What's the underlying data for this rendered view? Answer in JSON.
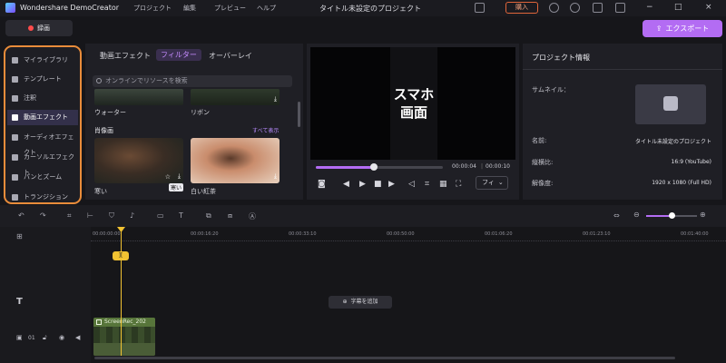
{
  "app": {
    "name": "Wondershare DemoCreator",
    "menu": [
      "プロジェクト",
      "編集",
      "プレビュー",
      "ヘルプ"
    ],
    "title": "タイトル未設定のプロジェクト",
    "buy_label": "購入",
    "window_controls": [
      "−",
      "□",
      "×"
    ]
  },
  "toolbar": {
    "record_label": "録画",
    "export_label": "エクスポート"
  },
  "sidebar": {
    "items": [
      {
        "label": "マイライブラリ",
        "icon": "stack-icon",
        "active": false
      },
      {
        "label": "テンプレート",
        "icon": "template-icon",
        "active": false
      },
      {
        "label": "注釈",
        "icon": "annotation-icon",
        "active": false
      },
      {
        "label": "動画エフェクト",
        "icon": "effects-icon",
        "active": true
      },
      {
        "label": "オーディオエフェクト",
        "icon": "audio-effects-icon",
        "active": false
      },
      {
        "label": "カーソルエフェクト",
        "icon": "cursor-icon",
        "active": false
      },
      {
        "label": "パンとズーム",
        "icon": "pan-zoom-icon",
        "active": false
      },
      {
        "label": "トランジション",
        "icon": "transition-icon",
        "active": false
      }
    ]
  },
  "library": {
    "tabs": [
      "動画エフェクト",
      "フィルター",
      "オーバーレイ"
    ],
    "active_tab": "フィルター",
    "search_placeholder": "オンラインでリソースを検索",
    "top_items": [
      "ウォーター",
      "リボン"
    ],
    "section_title": "肖像画",
    "see_all": "すべて表示",
    "items": [
      {
        "label": "寒い"
      },
      {
        "label": "白い紅茶"
      }
    ],
    "tooltip": "寒い"
  },
  "preview": {
    "overlay_line1": "スマホ",
    "overlay_line2": "画面",
    "progress": 0.46,
    "current_time": "00:00:04",
    "total_time": "00:00:10",
    "fit_label": "フィ",
    "controls": [
      "camera-icon",
      "prev-frame-icon",
      "play-icon",
      "stop-icon",
      "next-frame-icon",
      "volume-icon",
      "crop-icon",
      "grid-icon",
      "fullscreen-icon"
    ]
  },
  "project_info": {
    "title": "プロジェクト情報",
    "thumbnail_label": "サムネイル：",
    "rows": [
      {
        "label": "名前:",
        "value": "タイトル未設定のプロジェクト"
      },
      {
        "label": "縦横比:",
        "value": "16:9 (YouTube)"
      },
      {
        "label": "解像度:",
        "value": "1920 x 1080 (Full HD)"
      }
    ]
  },
  "timeline": {
    "ruler_ticks": [
      "00:00:00:00",
      "00:00:16:20",
      "00:00:33:10",
      "00:00:50:00",
      "00:01:06:20",
      "00:01:23:10",
      "00:01:40:00"
    ],
    "playhead_label": "][",
    "subtitle_button": "字幕を追加",
    "clip_name": "ScreenRec_202",
    "track_number": "01",
    "zoom_level": 0.5
  }
}
